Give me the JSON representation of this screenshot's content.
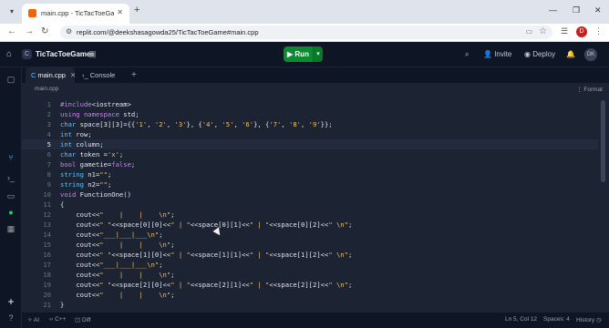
{
  "browser": {
    "tab_title": "main.cpp - TicTacToeGame - Re",
    "url": "replit.com/@deekshasagowda25/TicTacToeGame#main.cpp",
    "profile_initial": "D"
  },
  "app": {
    "repl_name": "TicTacToeGame",
    "run_label": "Run",
    "invite_label": "Invite",
    "deploy_label": "Deploy",
    "avatar_initials": "DK"
  },
  "tabs": [
    {
      "label": "main.cpp",
      "active": true
    },
    {
      "label": "Console",
      "active": false
    }
  ],
  "breadcrumb": "main.cpp",
  "format_label": "Format",
  "code_lines": [
    {
      "n": "1",
      "text": "#include<iostream>"
    },
    {
      "n": "2",
      "text": "using namespace std;"
    },
    {
      "n": "3",
      "text": "char space[3][3]={{'1', '2', '3'}, {'4', '5', '6'}, {'7', '8', '9'}};"
    },
    {
      "n": "4",
      "text": "int row;"
    },
    {
      "n": "5",
      "text": "int column;"
    },
    {
      "n": "6",
      "text": "char token ='x';"
    },
    {
      "n": "7",
      "text": "bool gametie=false;"
    },
    {
      "n": "8",
      "text": "string n1=\"\";"
    },
    {
      "n": "9",
      "text": "string n2=\"\";"
    },
    {
      "n": "10",
      "text": "void FunctionOne()"
    },
    {
      "n": "11",
      "text": "{"
    },
    {
      "n": "12",
      "text": "    cout<<\"    |    |    \\n\";"
    },
    {
      "n": "13",
      "text": "    cout<<\" \"<<space[0][0]<<\" | \"<<space[0][1]<<\" | \"<<space[0][2]<<\" \\n\";"
    },
    {
      "n": "14",
      "text": "    cout<<\"___|___|___\\n\";"
    },
    {
      "n": "15",
      "text": "    cout<<\"    |    |    \\n\";"
    },
    {
      "n": "16",
      "text": "    cout<<\" \"<<space[1][0]<<\" | \"<<space[1][1]<<\" | \"<<space[1][2]<<\" \\n\";"
    },
    {
      "n": "17",
      "text": "    cout<<\"___|___|___\\n\";"
    },
    {
      "n": "18",
      "text": "    cout<<\"    |    |    \\n\";"
    },
    {
      "n": "19",
      "text": "    cout<<\" \"<<space[2][0]<<\" | \"<<space[2][1]<<\" | \"<<space[2][2]<<\" \\n\";"
    },
    {
      "n": "20",
      "text": "    cout<<\"    |    |    \\n\";"
    },
    {
      "n": "21",
      "text": "}"
    }
  ],
  "status": {
    "ai_label": "AI",
    "lang_label": "C++",
    "diff_label": "Diff",
    "position": "Ln 5, Col 12",
    "spaces": "Spaces: 4",
    "history": "History"
  },
  "colors": {
    "keyword": "#c586e8",
    "type": "#5ec4ff",
    "string": "#f2c26b",
    "run_button": "#0b8a2f"
  }
}
